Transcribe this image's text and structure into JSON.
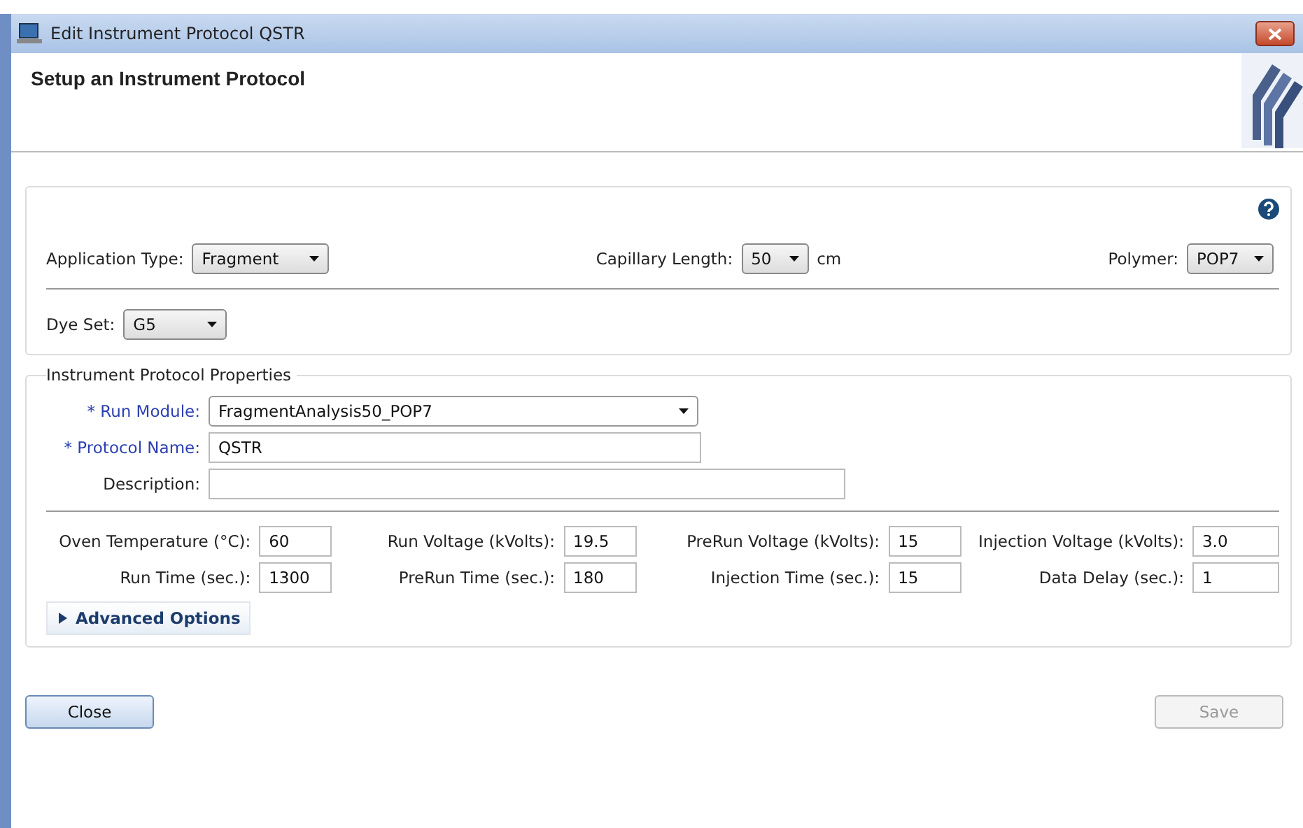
{
  "window": {
    "title": "Edit Instrument Protocol QSTR"
  },
  "header": {
    "title": "Setup an Instrument Protocol"
  },
  "settings": [
    {
      "label": "Application Type:",
      "value": "Fragment"
    },
    {
      "label": "Capillary Length:",
      "value": "50",
      "unit": "cm"
    },
    {
      "label": "Polymer:",
      "value": "POP7"
    }
  ],
  "dye_set": {
    "label": "Dye Set:",
    "value": "G5"
  },
  "properties": {
    "title": "Instrument Protocol Properties",
    "fields": [
      {
        "kind": "dropdown",
        "label": "* Run Module:",
        "value": "FragmentAnalysis50_POP7",
        "required": true
      },
      {
        "kind": "text",
        "label": "* Protocol Name:",
        "value": "QSTR",
        "required": true
      },
      {
        "kind": "text",
        "label": "Description:",
        "required": false
      }
    ],
    "parameters": [
      {
        "label": "Oven Temperature (°C):",
        "value": "60"
      },
      {
        "label": "Run Voltage (kVolts):",
        "value": "19.5"
      },
      {
        "label": "PreRun Voltage (kVolts):",
        "value": "15"
      },
      {
        "label": "Injection Voltage (kVolts):",
        "value": "3.0"
      },
      {
        "label": "Run Time (sec.):",
        "value": "1300"
      },
      {
        "label": "PreRun Time (sec.):",
        "value": "180"
      },
      {
        "label": "Injection Time (sec.):",
        "value": "15"
      },
      {
        "label": "Data Delay (sec.):",
        "value": "1"
      }
    ],
    "advanced": {
      "label": "Advanced Options",
      "expanded": false
    }
  },
  "buttons": [
    {
      "label": "Close",
      "disabled": false
    },
    {
      "label": "Save",
      "disabled": true
    }
  ]
}
